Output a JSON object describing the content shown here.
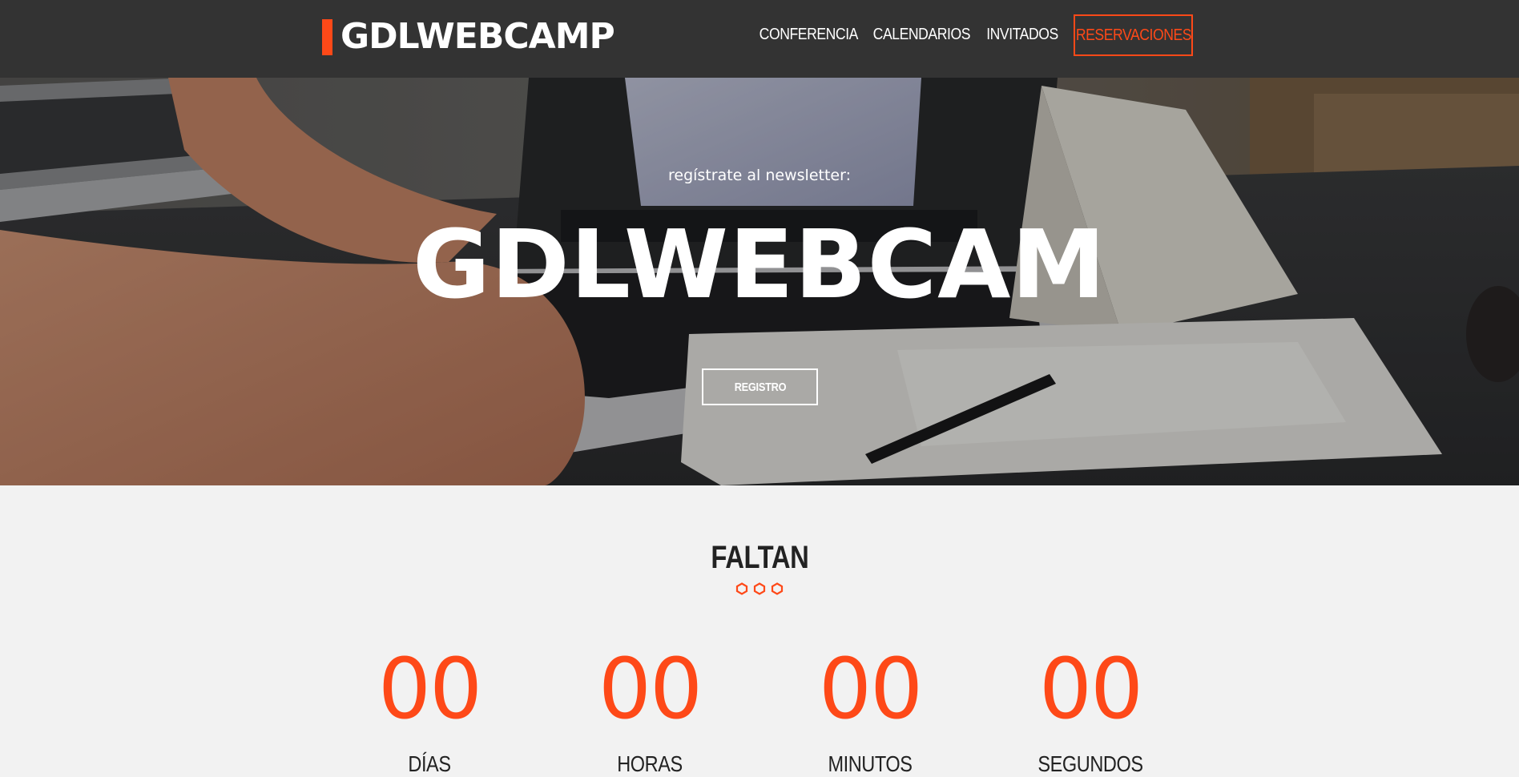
{
  "header": {
    "logo": "GDLWEBCAMP",
    "nav": [
      {
        "label": "CONFERENCIA"
      },
      {
        "label": "CALENDARIOS"
      },
      {
        "label": "INVITADOS"
      },
      {
        "label": "RESERVACIONES"
      }
    ]
  },
  "hero": {
    "newsletter_text": "regístrate al newsletter:",
    "title": "GDLWEBCAM",
    "button_label": "REGISTRO"
  },
  "countdown": {
    "title": "FALTAN",
    "counters": [
      {
        "value": "00",
        "label": "DÍAS"
      },
      {
        "value": "00",
        "label": "HORAS"
      },
      {
        "value": "00",
        "label": "MINUTOS"
      },
      {
        "value": "00",
        "label": "SEGUNDOS"
      }
    ]
  },
  "colors": {
    "accent": "#fe4918",
    "header_bg": "#333333",
    "page_bg": "#f2f2f2"
  }
}
